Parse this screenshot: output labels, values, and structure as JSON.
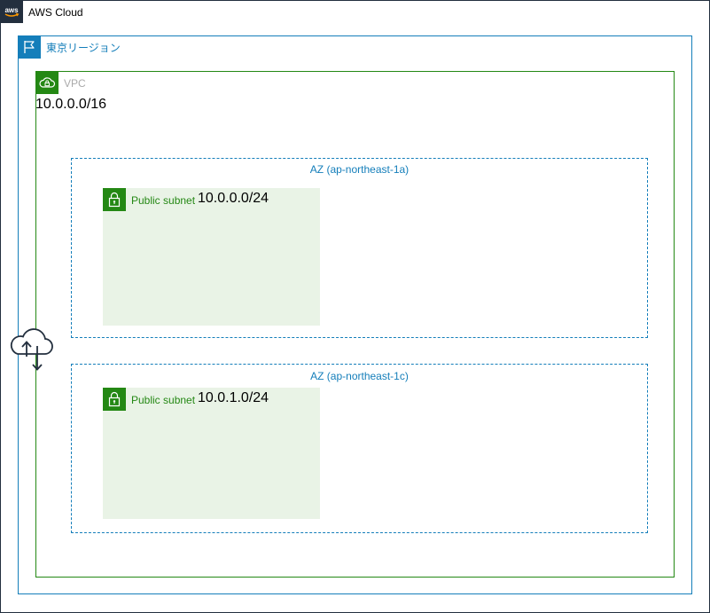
{
  "aws_cloud": {
    "label": "AWS Cloud",
    "logo_icon": "aws-logo-icon",
    "border_color": "#232f3e"
  },
  "region": {
    "label": "東京リージョン",
    "icon": "flag-icon",
    "color": "#147eba"
  },
  "vpc": {
    "label": "VPC",
    "cidr": "10.0.0.0/16",
    "icon": "vpc-cloud-lock-icon",
    "color": "#248814"
  },
  "availability_zones": [
    {
      "label": "AZ (ap-northeast-1a)",
      "subnet": {
        "label": "Public subnet",
        "cidr": "10.0.0.0/24",
        "icon": "lock-icon"
      }
    },
    {
      "label": "AZ (ap-northeast-1c)",
      "subnet": {
        "label": "Public subnet",
        "cidr": "10.0.1.0/24",
        "icon": "lock-icon"
      }
    }
  ],
  "internet_gateway": {
    "icon": "internet-gateway-icon"
  },
  "colors": {
    "subnet_fill": "#e9f3e6",
    "az_border": "#147eba"
  }
}
